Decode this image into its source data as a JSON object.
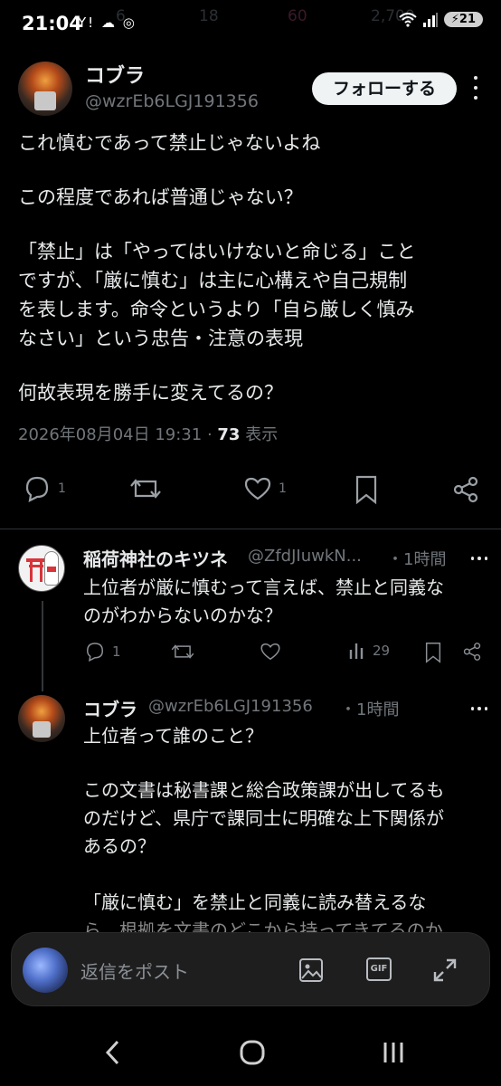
{
  "status_bar": {
    "time": "21:04",
    "left_icons": "Y! ☁ ◎",
    "battery": "21",
    "ghost_counts": [
      "6",
      "18",
      "60",
      "2,700"
    ]
  },
  "main_tweet": {
    "name": "コブラ",
    "handle": "@wzrEb6LGJ191356",
    "follow_label": "フォローする",
    "lines": [
      "これ慎むであって禁止じゃないよね",
      "",
      "この程度であれば普通じゃない？",
      "",
      "「禁止」は「やってはいけないと命じる」こと",
      "ですが、「厳に慎む」は主に心構えや自己規制",
      "を表します。命令というより「自ら厳しく慎み",
      "なさい」という忠告・注意の表現",
      "",
      "何故表現を勝手に変えてるの？"
    ],
    "timestamp": "2026年08月04日 19:31",
    "view_count": "73",
    "view_label": "表示",
    "reply_count": "1",
    "like_count": "1"
  },
  "reply1": {
    "name": "稲荷神社のキツネ",
    "handle": "@ZfdJIuwkN...",
    "time": "・1時間",
    "lines": [
      "上位者が厳に慎むって言えば、禁止と同義な",
      "のがわからないのかな？"
    ],
    "reply_count": "1",
    "views": "29"
  },
  "reply2": {
    "name": "コブラ",
    "handle": "@wzrEb6LGJ191356",
    "time": "・1時間",
    "lines": [
      "上位者って誰のこと？",
      "",
      "この文書は秘書課と総合政策課が出してるも",
      "のだけど、県庁で課同士に明確な上下関係が",
      "あるの？",
      "",
      "「厳に慎む」を禁止と同義に読み替えるな",
      "ら、根拠を文書のどこから持ってきてるのか"
    ]
  },
  "composer": {
    "placeholder": "返信をポスト",
    "gif_label": "GIF"
  },
  "colors": {
    "background": "#000000",
    "text": "#e7e9ea",
    "secondary": "#71767b",
    "like_pink": "#f91880"
  }
}
